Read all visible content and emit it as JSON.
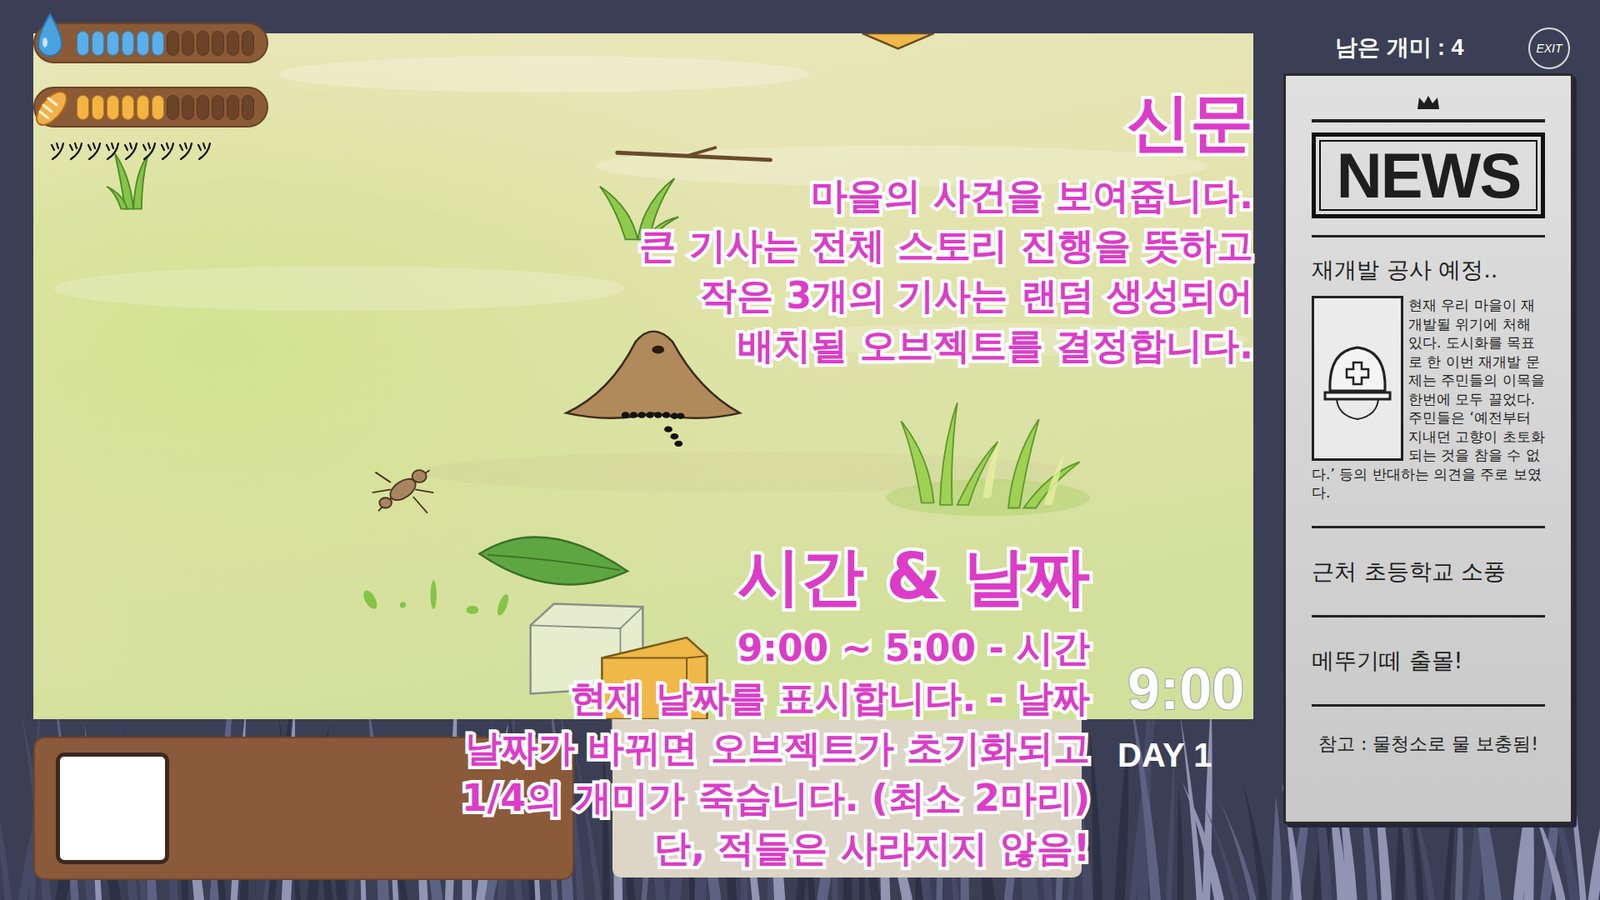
{
  "hud": {
    "water": {
      "level": 0.5,
      "slots": 12
    },
    "food": {
      "level": 0.5,
      "slots": 12
    },
    "stamina_marks": 9
  },
  "ants_remaining": "남은 개미 : 4",
  "exit_button": "EXIT",
  "newspaper": {
    "masthead": "NEWS",
    "main_article": {
      "headline": "재개발 공사 예정..",
      "body": "현재 우리 마을이 재개발될 위기에 처해 있다. 도시화를 목표로 한 이번 재개발 문제는 주민들의 이목을 한번에 모두 끌었다. 주민들은 ‘예전부터 지내던 고향이 초토화되는 것을 참을 수 없다.’ 등의 반대하는 의견을 주로 보였다."
    },
    "articles": [
      "근처 초등학교 소풍",
      "메뚜기떼 출몰!"
    ],
    "note": "참고 : 물청소로 물 보충됨!"
  },
  "clock": {
    "time": "9:00",
    "day": "DAY 1"
  },
  "inventory": {
    "slots": [
      {
        "empty": true
      }
    ]
  },
  "tutorial": [
    {
      "title": "신문",
      "lines": [
        "마을의 사건을 보여줍니다.",
        "큰 기사는 전체 스토리 진행을 뜻하고",
        "작은 3개의 기사는 랜덤 생성되어",
        "배치될 오브젝트를 결정합니다."
      ]
    },
    {
      "title": "시간 & 날짜",
      "lines": [
        "9:00 ~ 5:00 - 시간",
        "현재 날짜를 표시합니다. - 날짜",
        "날짜가 바뀌면 오브젝트가 초기화되고",
        "1/4의 개미가 죽습니다. (최소 2마리)",
        "단, 적들은 사라지지 않음!"
      ]
    }
  ]
}
